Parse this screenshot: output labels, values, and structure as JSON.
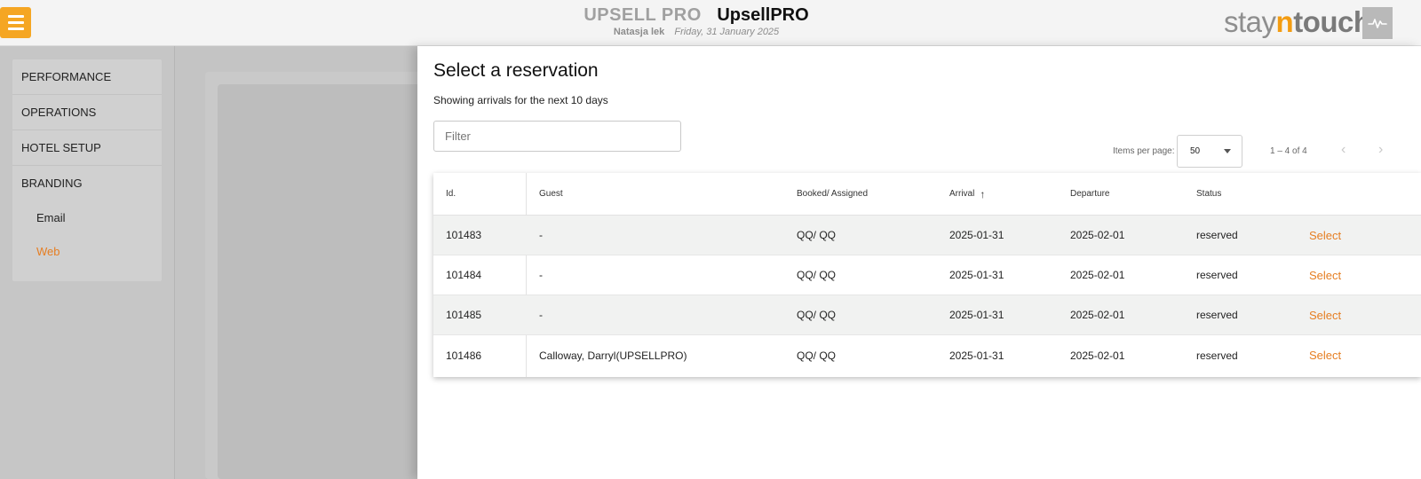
{
  "header": {
    "product": "UPSELL PRO",
    "hotel": "UpsellPRO",
    "user": "Natasja lek",
    "date": "Friday, 31 January 2025",
    "logo_part1": "stay",
    "logo_part2": "n",
    "logo_part3": "touch"
  },
  "sidebar": {
    "items": [
      {
        "label": "PERFORMANCE"
      },
      {
        "label": "OPERATIONS"
      },
      {
        "label": "HOTEL SETUP"
      },
      {
        "label": "BRANDING"
      }
    ],
    "subitems": [
      {
        "label": "Email"
      },
      {
        "label": "Web",
        "active": true
      }
    ]
  },
  "panel": {
    "title": "Select a reservation",
    "subtitle": "Showing arrivals for the next 10 days",
    "filter_placeholder": "Filter"
  },
  "pagination": {
    "items_label": "Items per page:",
    "items_value": "50",
    "range": "1 – 4 of 4",
    "prev_glyph": "‹",
    "next_glyph": "›"
  },
  "table": {
    "headers": {
      "id": "Id.",
      "guest": "Guest",
      "booked": "Booked/ Assigned",
      "arrival": "Arrival",
      "departure": "Departure",
      "status": "Status"
    },
    "sort_glyph": "↑",
    "rows": [
      {
        "id": "101483",
        "guest": "-",
        "booked": "QQ/ QQ",
        "arrival": "2025-01-31",
        "departure": "2025-02-01",
        "status": "reserved",
        "action": "Select"
      },
      {
        "id": "101484",
        "guest": "-",
        "booked": "QQ/ QQ",
        "arrival": "2025-01-31",
        "departure": "2025-02-01",
        "status": "reserved",
        "action": "Select"
      },
      {
        "id": "101485",
        "guest": "-",
        "booked": "QQ/ QQ",
        "arrival": "2025-01-31",
        "departure": "2025-02-01",
        "status": "reserved",
        "action": "Select"
      },
      {
        "id": "101486",
        "guest": "Calloway, Darryl(UPSELLPRO)",
        "booked": "QQ/ QQ",
        "arrival": "2025-01-31",
        "departure": "2025-02-01",
        "status": "reserved",
        "action": "Select"
      }
    ]
  },
  "colors": {
    "accent": "#f5a623",
    "link": "#e67e22"
  }
}
